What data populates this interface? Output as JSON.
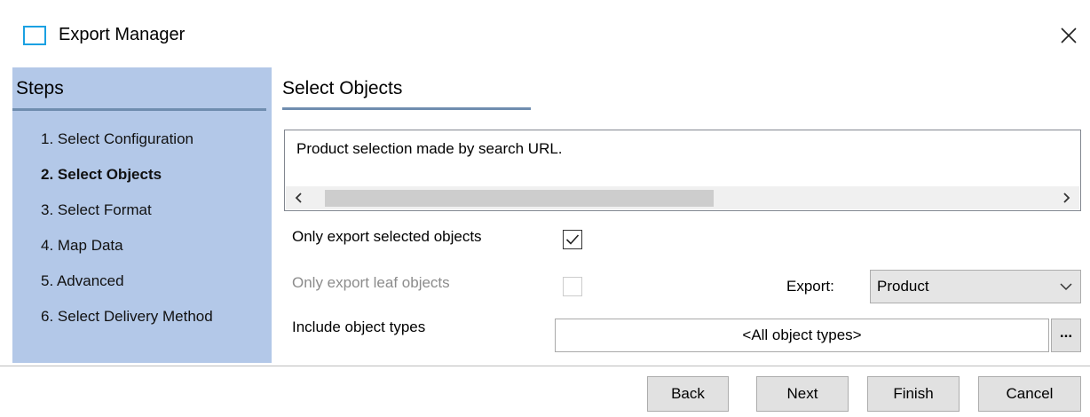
{
  "window": {
    "title": "Export Manager",
    "icon": "window-icon",
    "close_icon": "close-icon",
    "accent_color": "#1ba1e2"
  },
  "steps": {
    "title": "Steps",
    "panel_color": "#b3c8e8",
    "items": [
      {
        "label": "1. Select Configuration",
        "active": false
      },
      {
        "label": "2. Select Objects",
        "active": true
      },
      {
        "label": "3. Select Format",
        "active": false
      },
      {
        "label": "4. Map Data",
        "active": false
      },
      {
        "label": "5. Advanced",
        "active": false
      },
      {
        "label": "6. Select Delivery Method",
        "active": false
      }
    ]
  },
  "main": {
    "title": "Select Objects",
    "description": "Product selection made by search URL.",
    "scrollbar": {
      "left_icon": "chevron-left-icon",
      "right_icon": "chevron-right-icon"
    },
    "only_selected": {
      "label": "Only export selected objects",
      "checked": true,
      "enabled": true
    },
    "only_leaf": {
      "label": "Only export leaf objects",
      "checked": false,
      "enabled": false
    },
    "export": {
      "label": "Export:",
      "value": "Product",
      "icon": "chevron-down-icon"
    },
    "include_types": {
      "label": "Include object types",
      "value": "<All object types>",
      "browse_label": "..."
    }
  },
  "footer": {
    "back_label": "Back",
    "next_label": "Next",
    "finish_label": "Finish",
    "cancel_label": "Cancel"
  }
}
